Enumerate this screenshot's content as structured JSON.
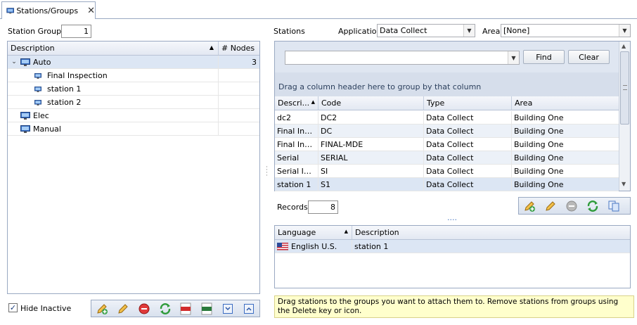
{
  "tab": {
    "title": "Stations/Groups"
  },
  "left": {
    "station_groups_label": "Station Groups",
    "station_groups_count": "1",
    "columns": {
      "description": "Description",
      "nodes": "# Nodes"
    },
    "tree": [
      {
        "label": "Auto",
        "nodes": "3",
        "level": 0,
        "expanded": true,
        "selected": true
      },
      {
        "label": "Final Inspection",
        "nodes": "",
        "level": 1
      },
      {
        "label": "station 1",
        "nodes": "",
        "level": 1
      },
      {
        "label": "station 2",
        "nodes": "",
        "level": 1
      },
      {
        "label": "Elec",
        "nodes": "",
        "level": 0
      },
      {
        "label": "Manual",
        "nodes": "",
        "level": 0
      }
    ],
    "hide_inactive_label": "Hide Inactive",
    "hide_inactive_checked": true
  },
  "right": {
    "stations_label": "Stations",
    "application_label": "Application",
    "application_value": "Data Collect",
    "area_label": "Area",
    "area_value": "[None]",
    "search_value": "",
    "find_label": "Find",
    "clear_label": "Clear",
    "group_panel_text": "Drag a column header here to group by that column",
    "columns": {
      "description": "Descri...",
      "code": "Code",
      "type": "Type",
      "area": "Area"
    },
    "rows": [
      {
        "description": "dc2",
        "code": "DC2",
        "type": "Data Collect",
        "area": "Building One"
      },
      {
        "description": "Final Ins...",
        "code": "DC",
        "type": "Data Collect",
        "area": "Building One"
      },
      {
        "description": "Final Ins...",
        "code": "FINAL-MDE",
        "type": "Data Collect",
        "area": "Building One"
      },
      {
        "description": "Serial",
        "code": "SERIAL",
        "type": "Data Collect",
        "area": "Building One"
      },
      {
        "description": "Serial Ins...",
        "code": "SI",
        "type": "Data Collect",
        "area": "Building One"
      },
      {
        "description": "station 1",
        "code": "S1",
        "type": "Data Collect",
        "area": "Building One"
      }
    ],
    "records_label": "Records",
    "records_count": "8",
    "lang_columns": {
      "language": "Language",
      "description": "Description"
    },
    "lang_rows": [
      {
        "language": "English U.S.",
        "description": "station 1"
      }
    ],
    "hint_text": "Drag stations to the groups you want to attach them to. Remove stations from groups using the Delete key or icon."
  }
}
